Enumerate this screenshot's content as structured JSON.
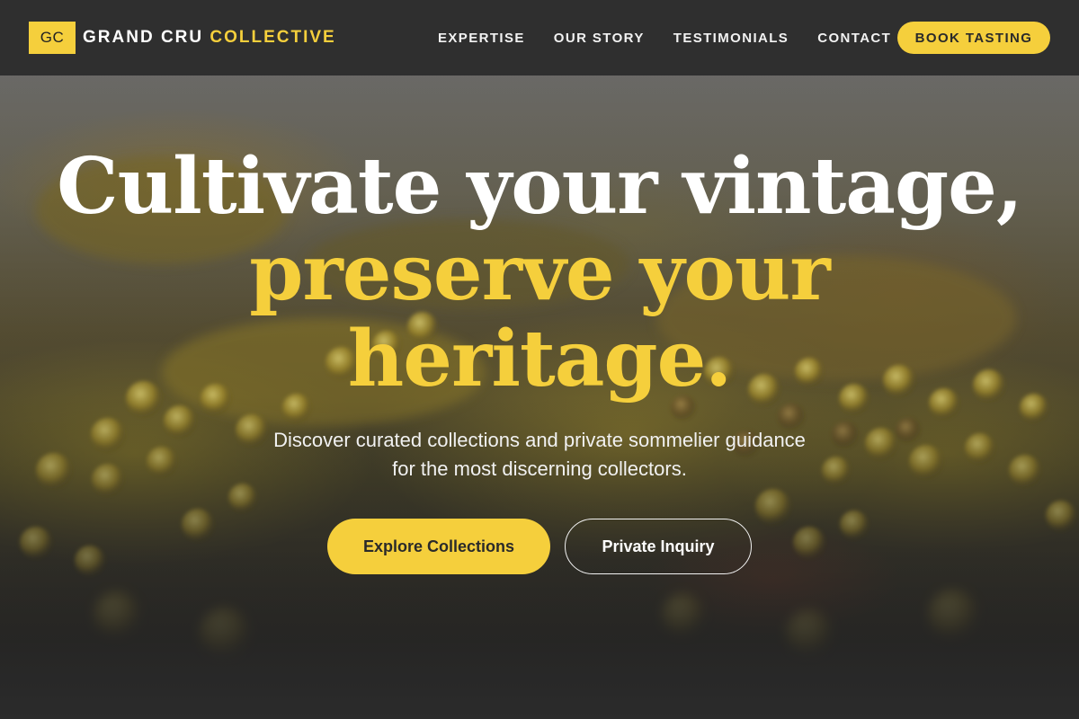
{
  "header": {
    "logo_mark": "GC",
    "brand_primary": "GRAND CRU",
    "brand_accent": "COLLECTIVE",
    "nav": [
      {
        "label": "EXPERTISE"
      },
      {
        "label": "OUR STORY"
      },
      {
        "label": "TESTIMONIALS"
      },
      {
        "label": "CONTACT"
      }
    ],
    "cta_label": "BOOK TASTING"
  },
  "hero": {
    "headline_line1": "Cultivate your vintage,",
    "headline_line2": "preserve your",
    "headline_line3": "heritage.",
    "subtitle": "Discover curated collections and private sommelier guidance for the most discerning collectors.",
    "primary_button": "Explore Collections",
    "secondary_button": "Private Inquiry"
  },
  "colors": {
    "accent": "#f5cf3c",
    "header_bg": "#2f2f2f",
    "text_light": "#ffffff"
  }
}
